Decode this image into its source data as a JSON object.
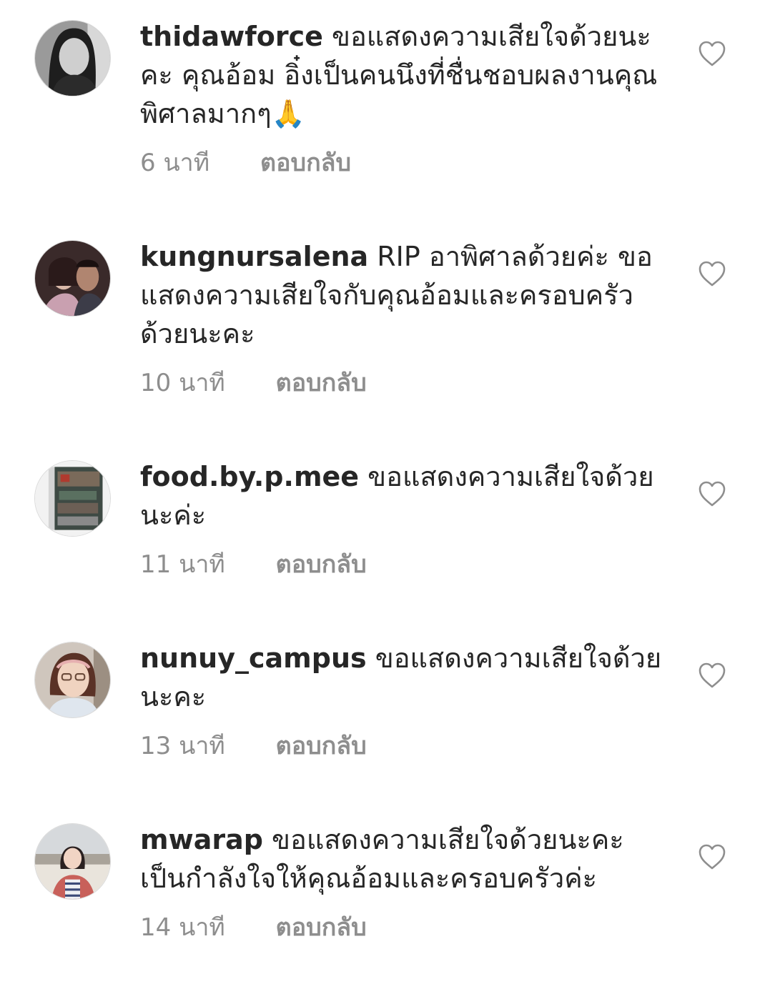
{
  "comments": [
    {
      "username": "thidawforce",
      "text": "ขอแสดงความเสียใจด้วยนะคะ คุณอ้อม อิ๋งเป็นคนนึงที่ชื่นชอบผลงานคุณพิศาลมากๆ🙏",
      "time": "6 นาที",
      "reply_label": "ตอบกลับ",
      "avatar_icon": "profile-photo"
    },
    {
      "username": "kungnursalena",
      "text": "RIP อาพิศาลด้วยค่ะ ขอแสดงความเสียใจกับคุณอ้อมและครอบครัวด้วยนะคะ",
      "time": "10 นาที",
      "reply_label": "ตอบกลับ",
      "avatar_icon": "profile-photo"
    },
    {
      "username": "food.by.p.mee",
      "text": "ขอแสดงความเสียใจด้วยนะค่ะ",
      "time": "11 นาที",
      "reply_label": "ตอบกลับ",
      "avatar_icon": "profile-photo"
    },
    {
      "username": "nunuy_campus",
      "text": "ขอแสดงความเสียใจด้วยนะคะ",
      "time": "13 นาที",
      "reply_label": "ตอบกลับ",
      "avatar_icon": "profile-photo"
    },
    {
      "username": "mwarap",
      "text": "ขอแสดงความเสียใจด้วยนะคะ เป็นกำลังใจให้คุณอ้อมและครอบครัวค่ะ",
      "time": "14 นาที",
      "reply_label": "ตอบกลับ",
      "avatar_icon": "profile-photo"
    }
  ],
  "colors": {
    "username": "#262626",
    "meta": "#8e8e8e",
    "heart_outline": "#8e8e8e"
  }
}
